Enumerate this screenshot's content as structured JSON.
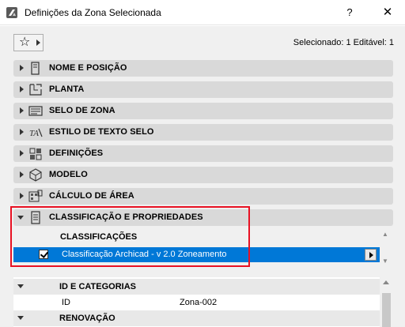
{
  "window": {
    "title": "Definições da Zona Selecionada",
    "help_label": "?",
    "close_label": "✕"
  },
  "toolbar": {
    "favorites_icon": "star-icon",
    "selection_info": "Selecionado: 1 Editável: 1"
  },
  "panels": [
    {
      "label": "NOME E POSIÇÃO",
      "icon": "name-position-icon",
      "expanded": false
    },
    {
      "label": "PLANTA",
      "icon": "floor-plan-icon",
      "expanded": false
    },
    {
      "label": "SELO DE ZONA",
      "icon": "zone-stamp-icon",
      "expanded": false
    },
    {
      "label": "ESTILO DE TEXTO SELO",
      "icon": "text-style-icon",
      "expanded": false
    },
    {
      "label": "DEFINIÇÕES",
      "icon": "settings-icon",
      "expanded": false
    },
    {
      "label": "MODELO",
      "icon": "model-3d-icon",
      "expanded": false
    },
    {
      "label": "CÁLCULO DE ÁREA",
      "icon": "area-calculation-icon",
      "expanded": false
    },
    {
      "label": "CLASSIFICAÇÃO E PROPRIEDADES",
      "icon": "document-icon",
      "expanded": true
    }
  ],
  "classification": {
    "heading": "CLASSIFICAÇÕES",
    "checked": true,
    "row_text": "Classificação Archicad - v 2.0   Zoneamento"
  },
  "properties": {
    "group1": "ID E CATEGORIAS",
    "id_label": "ID",
    "id_value": "Zona-002",
    "group2": "RENOVAÇÃO"
  },
  "colors": {
    "highlight": "#0078d7",
    "annotation_box": "#e81123",
    "panel_bg": "#d9d9d9"
  }
}
